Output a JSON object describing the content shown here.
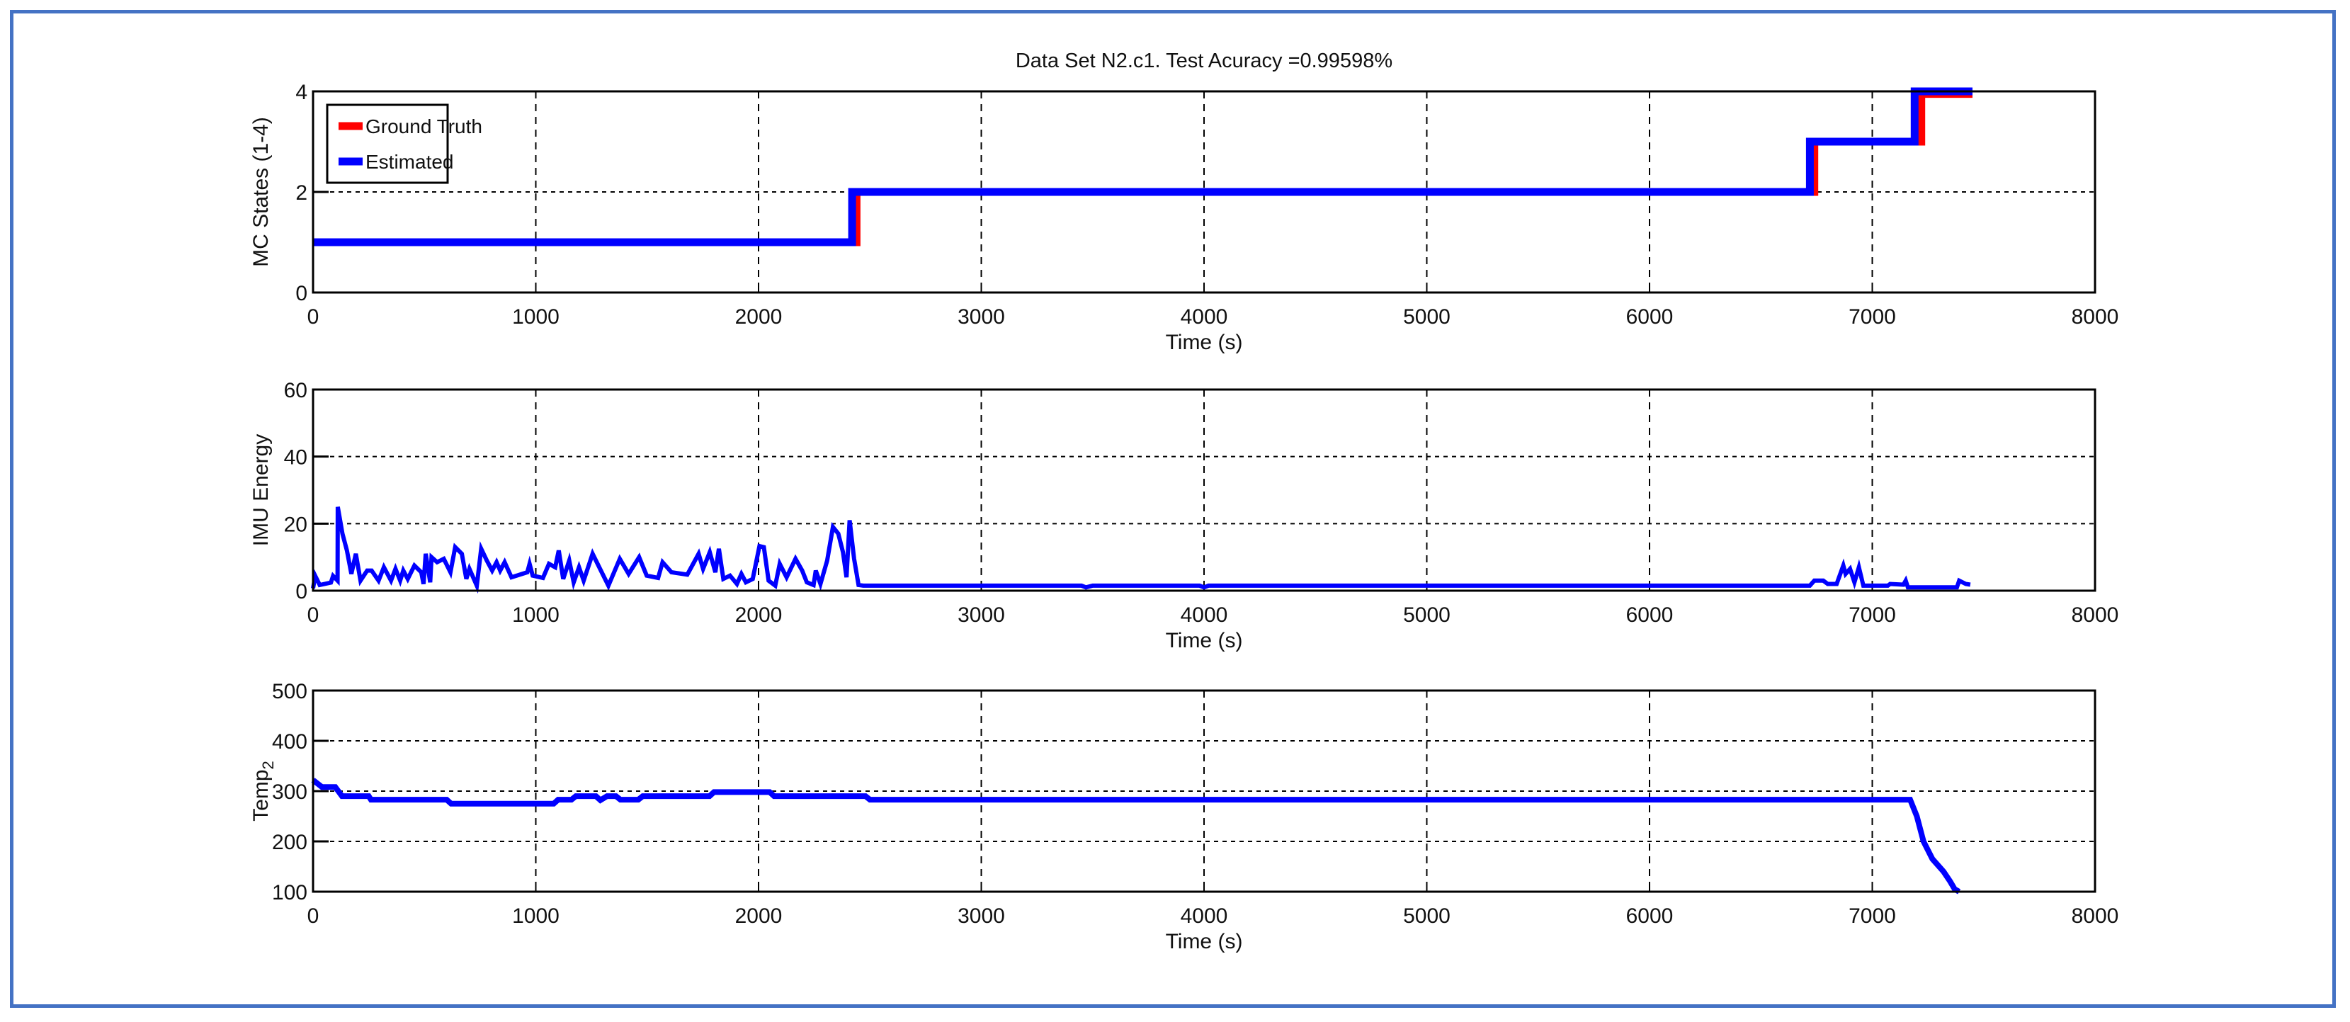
{
  "colors": {
    "ground_truth": "#ff0000",
    "estimated": "#0000ff",
    "frame": "#4472c4"
  },
  "chart_data": [
    {
      "type": "line",
      "title": "Data Set N2.c1. Test Acuracy =0.99598%",
      "xlabel": "Time (s)",
      "ylabel": "MC States (1-4)",
      "xlim": [
        0,
        8000
      ],
      "ylim": [
        0,
        4
      ],
      "xticks": [
        "0",
        "1000",
        "2000",
        "3000",
        "4000",
        "5000",
        "6000",
        "7000",
        "8000"
      ],
      "yticks": [
        "0",
        "2",
        "4"
      ],
      "ytick_values": [
        0,
        2,
        4
      ],
      "grid": true,
      "legend": {
        "placement": "top-left",
        "entries": [
          "Ground Truth",
          "Estimated"
        ]
      },
      "series": [
        {
          "name": "Ground Truth",
          "x": [
            0,
            2440,
            2440,
            6740,
            6740,
            7220,
            7220,
            7450
          ],
          "y": [
            1,
            1,
            2,
            2,
            3,
            3,
            3.95,
            3.95
          ]
        },
        {
          "name": "Estimated",
          "x": [
            0,
            2420,
            2420,
            6720,
            6720,
            7190,
            7190,
            7450
          ],
          "y": [
            1,
            1,
            2,
            2,
            3,
            3,
            4,
            4
          ]
        }
      ]
    },
    {
      "type": "line",
      "xlabel": "Time (s)",
      "ylabel": "IMU Energy",
      "xlim": [
        0,
        8000
      ],
      "ylim": [
        0,
        60
      ],
      "xticks": [
        "0",
        "1000",
        "2000",
        "3000",
        "4000",
        "5000",
        "6000",
        "7000",
        "8000"
      ],
      "yticks": [
        "0",
        "20",
        "40",
        "60"
      ],
      "ytick_values": [
        0,
        20,
        40,
        60
      ],
      "grid": true,
      "series": [
        {
          "name": "IMU Energy",
          "x": [
            0,
            10,
            30,
            80,
            90,
            110,
            111,
            132,
            152,
            172,
            192,
            213,
            243,
            263,
            294,
            318,
            350,
            370,
            391,
            405,
            425,
            455,
            486,
            496,
            506,
            526,
            532,
            557,
            587,
            617,
            638,
            668,
            688,
            702,
            735,
            755,
            780,
            804,
            824,
            840,
            860,
            891,
            962,
            972,
            986,
            1032,
            1059,
            1087,
            1103,
            1123,
            1150,
            1170,
            1194,
            1215,
            1255,
            1296,
            1326,
            1377,
            1417,
            1464,
            1498,
            1549,
            1569,
            1609,
            1680,
            1731,
            1751,
            1781,
            1806,
            1822,
            1842,
            1872,
            1903,
            1923,
            1943,
            1974,
            2004,
            2024,
            2045,
            2075,
            2095,
            2126,
            2166,
            2196,
            2217,
            2247,
            2257,
            2278,
            2308,
            2334,
            2358,
            2379,
            2395,
            2409,
            2429,
            2449,
            2470,
            3450,
            3470,
            3500,
            3980,
            4000,
            4020,
            6720,
            6740,
            6780,
            6800,
            6840,
            6870,
            6880,
            6900,
            6920,
            6940,
            6960,
            7070,
            7080,
            7140,
            7150,
            7160,
            7380,
            7390,
            7420,
            7440
          ],
          "y": [
            0.7,
            4.4,
            1.7,
            2.4,
            4.4,
            3,
            25,
            17,
            12,
            5,
            11,
            3,
            6,
            6,
            3,
            7,
            3,
            6.5,
            3,
            6,
            3.5,
            7.5,
            5.5,
            2,
            11,
            2.5,
            10,
            8.5,
            9.5,
            5.5,
            13,
            11,
            3.5,
            6.5,
            1.5,
            12.5,
            9,
            6,
            8.5,
            6,
            8.5,
            4,
            5.5,
            8,
            4.5,
            3.8,
            8,
            7,
            12,
            3.5,
            9,
            2.5,
            7,
            3,
            11,
            5.5,
            1.5,
            9.5,
            5,
            10,
            4.5,
            3.8,
            8.5,
            5.5,
            4.8,
            11,
            6.5,
            11.5,
            5.5,
            12.5,
            3.5,
            4.5,
            2,
            5,
            2.5,
            3.5,
            13.3,
            13,
            3,
            1.5,
            8,
            4,
            9.5,
            6,
            2.5,
            1.7,
            6,
            2,
            9,
            19,
            17,
            11.5,
            4,
            21,
            9.5,
            1.7,
            1.5,
            1.5,
            1.0,
            1.5,
            1.5,
            1.0,
            1.5,
            1.5,
            3,
            3,
            2,
            2,
            7.5,
            5,
            6.5,
            2.5,
            7,
            1.5,
            1.5,
            2,
            1.8,
            3,
            1,
            1,
            3,
            2,
            1.8
          ]
        }
      ]
    },
    {
      "type": "line",
      "xlabel": "Time (s)",
      "ylabel": "Temp",
      "ylabel_subscript": "2",
      "xlim": [
        0,
        8000
      ],
      "ylim": [
        100,
        500
      ],
      "xticks": [
        "0",
        "1000",
        "2000",
        "3000",
        "4000",
        "5000",
        "6000",
        "7000",
        "8000"
      ],
      "yticks": [
        "100",
        "200",
        "300",
        "400",
        "500"
      ],
      "ytick_values": [
        100,
        200,
        300,
        400,
        500
      ],
      "grid": true,
      "series": [
        {
          "name": "Temp2",
          "x": [
            0,
            40,
            100,
            130,
            250,
            260,
            600,
            620,
            1080,
            1100,
            1160,
            1180,
            1270,
            1290,
            1320,
            1360,
            1380,
            1460,
            1480,
            1780,
            1800,
            2050,
            2070,
            2480,
            2500,
            7170,
            7200,
            7230,
            7270,
            7320,
            7350,
            7370,
            7390
          ],
          "y": [
            322,
            308,
            308,
            290,
            290,
            283,
            283,
            275,
            275,
            283,
            283,
            290,
            290,
            282,
            290,
            290,
            283,
            283,
            290,
            290,
            298,
            298,
            290,
            290,
            283,
            283,
            250,
            200,
            165,
            140,
            120,
            105,
            100
          ]
        }
      ]
    }
  ]
}
